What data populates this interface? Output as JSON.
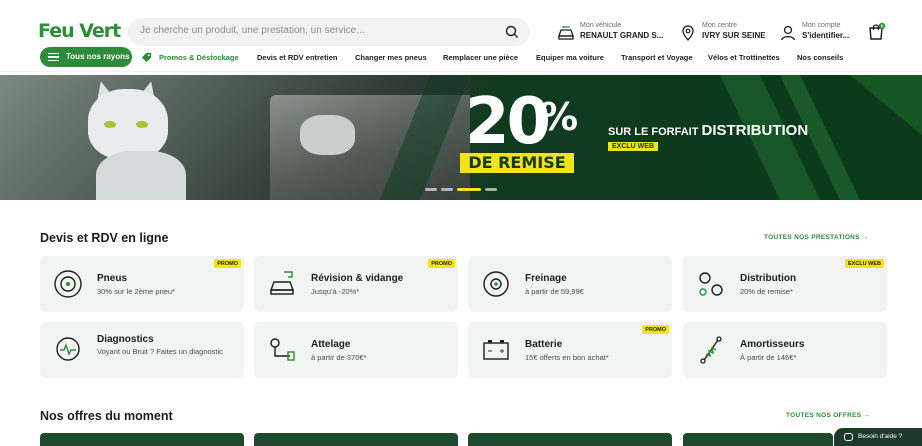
{
  "header": {
    "logo": "Feu Vert",
    "search_placeholder": "Je cherche un produit, une prestation, un service...",
    "vehicle": {
      "label": "Mon véhicule",
      "value": "RENAULT GRAND S..."
    },
    "centre": {
      "label": "Mon centre",
      "value": "IVRY SUR SEINE"
    },
    "account": {
      "label": "Mon compte",
      "value": "S'identifier..."
    },
    "cart_count": "0"
  },
  "nav": {
    "rayons": "Tous nos rayons",
    "items": [
      "Promos & Déstockage",
      "Devis et RDV entretien",
      "Changer mes pneus",
      "Remplacer une pièce",
      "Equiper ma voiture",
      "Transport et Voyage",
      "Vélos et Trottinettes",
      "Nos conseils"
    ]
  },
  "banner": {
    "percent": "20",
    "percent_sign": "%",
    "remise": "DE REMISE",
    "line_a": "SUR LE FORFAIT ",
    "line_b": "DISTRIBUTION",
    "exclu": "EXCLU WEB",
    "slides": 5,
    "active_slide": 3
  },
  "services": {
    "title": "Devis et RDV en ligne",
    "link": "TOUTES NOS PRESTATIONS →",
    "cards": [
      {
        "title": "Pneus",
        "sub": "30% sur le 2ème pneu*",
        "badge": "PROMO",
        "icon": "tire-icon"
      },
      {
        "title": "Révision & vidange",
        "sub": "Jusqu'à -20%*",
        "badge": "PROMO",
        "icon": "car-service-icon"
      },
      {
        "title": "Freinage",
        "sub": "à partir de 59,99€",
        "badge": "",
        "icon": "brake-disc-icon"
      },
      {
        "title": "Distribution",
        "sub": "20% de remise*",
        "badge": "EXCLU WEB",
        "icon": "timing-belt-icon"
      },
      {
        "title": "Diagnostics",
        "sub": "Voyant ou Bruit ? Faites un diagnostic",
        "badge": "",
        "icon": "diagnostic-icon"
      },
      {
        "title": "Attelage",
        "sub": "à partir de 370€*",
        "badge": "",
        "icon": "tow-hitch-icon"
      },
      {
        "title": "Batterie",
        "sub": "15€ offerts en bon achat*",
        "badge": "PROMO",
        "icon": "battery-icon"
      },
      {
        "title": "Amortisseurs",
        "sub": "À partir de 146€*",
        "badge": "",
        "icon": "shock-absorber-icon"
      }
    ]
  },
  "offers": {
    "title": "Nos offres du moment",
    "link": "TOUTES NOS OFFRES →"
  },
  "help": "Besoin d'aide ?",
  "colors": {
    "brand_green": "#2e8b3a",
    "promo_yellow": "#f3e31b",
    "dark_green": "#0f3a1e"
  }
}
